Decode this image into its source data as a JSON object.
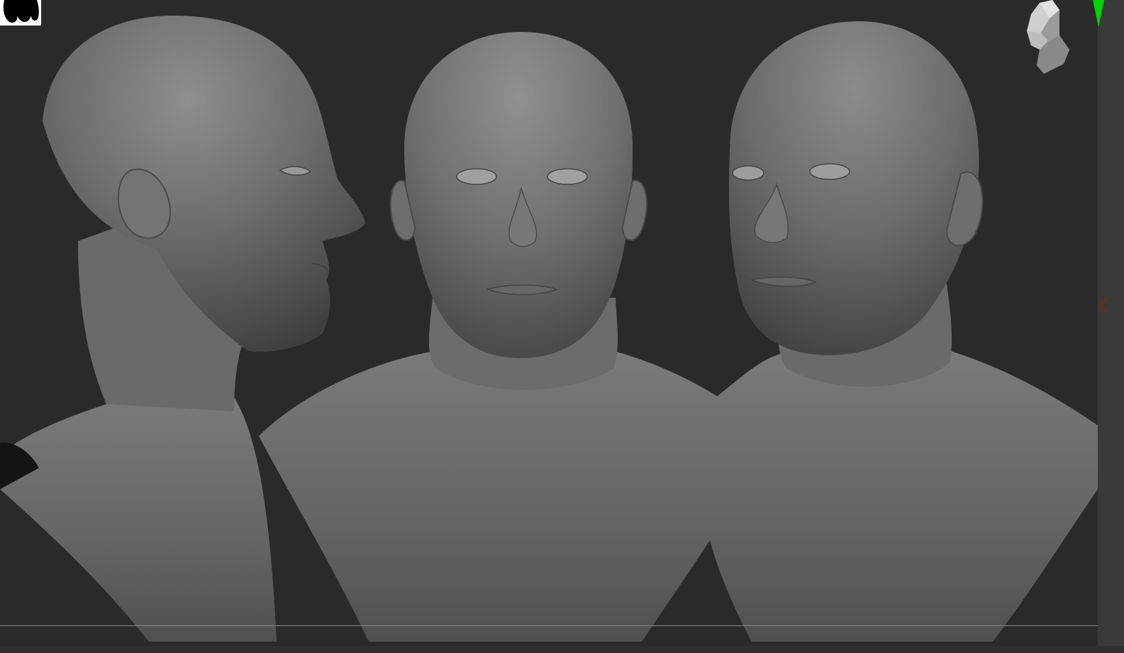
{
  "app": {
    "canvas_background": "#2a2a2a",
    "gutter_color": "#3a3a3a",
    "accent_green": "#00d400",
    "accent_red": "#b01010"
  },
  "viewport": {
    "views": [
      {
        "id": "side",
        "description": "profile-view"
      },
      {
        "id": "front",
        "description": "front-view"
      },
      {
        "id": "three-quarter",
        "description": "three-quarter-view"
      }
    ]
  },
  "icons": {
    "corner_logo": "app-logo-icon",
    "nav_cube": "head-orientation-icon",
    "green_marker": "green-indicator-icon",
    "red_marker": "red-indicator-icon"
  }
}
